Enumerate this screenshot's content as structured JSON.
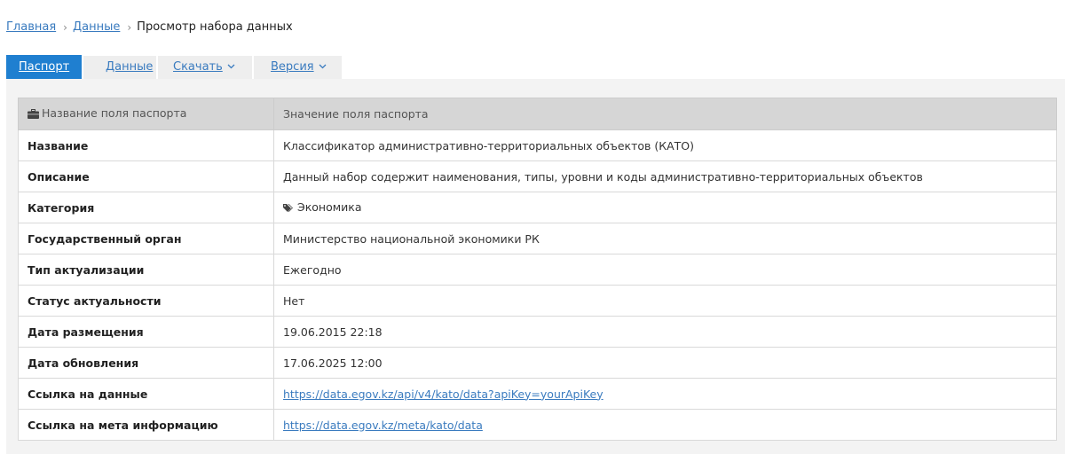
{
  "breadcrumb": {
    "home": "Главная",
    "data": "Данные",
    "current": "Просмотр набора данных",
    "separator": "›"
  },
  "tabs": {
    "passport": "Паспорт",
    "data": "Данные",
    "download": "Скачать",
    "version": "Версия"
  },
  "icons": {
    "header": "briefcase-icon",
    "category": "tags-icon",
    "dropdown": "chevron-down-icon"
  },
  "colors": {
    "accent": "#1f7fd0",
    "link": "#3a7bbf",
    "header_bg": "#d6d6d6"
  },
  "table": {
    "header_key": "Название поля паспорта",
    "header_value": "Значение поля паспорта",
    "rows": [
      {
        "key": "Название",
        "value": "Классификатор административно-территориальных объектов (КАТО)"
      },
      {
        "key": "Описание",
        "value": "Данный набор содержит наименования, типы, уровни и коды административно-территориальных объектов"
      },
      {
        "key": "Категория",
        "value": "Экономика"
      },
      {
        "key": "Государственный орган",
        "value": "Министерство национальной экономики РК"
      },
      {
        "key": "Тип актуализации",
        "value": "Ежегодно"
      },
      {
        "key": "Статус актуальности",
        "value": "Нет"
      },
      {
        "key": "Дата размещения",
        "value": "19.06.2015 22:18"
      },
      {
        "key": "Дата обновления",
        "value": "17.06.2025 12:00"
      },
      {
        "key": "Ссылка на данные",
        "value": "https://data.egov.kz/api/v4/kato/data?apiKey=yourApiKey"
      },
      {
        "key": "Ссылка на мета информацию",
        "value": "https://data.egov.kz/meta/kato/data"
      }
    ]
  }
}
